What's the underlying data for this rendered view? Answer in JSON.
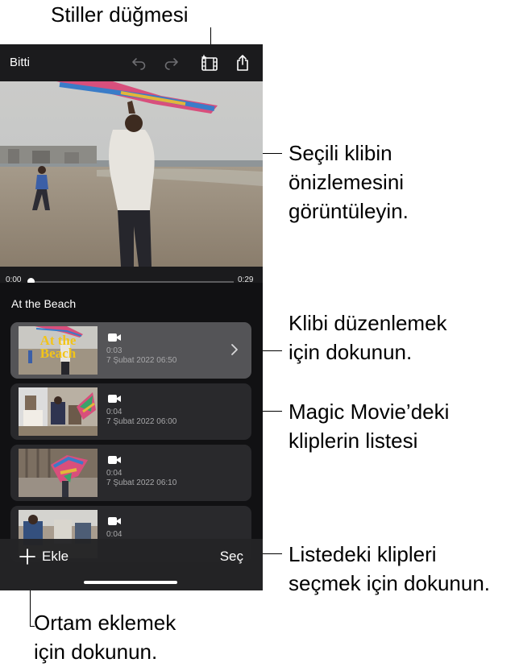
{
  "callouts": {
    "styles_button": "Stiller düğmesi",
    "preview": [
      "Seçili klibin",
      "önizlemesini",
      "görüntüleyin."
    ],
    "tap_edit": [
      "Klibi düzenlemek",
      "için dokunun."
    ],
    "clip_list": [
      "Magic Movie’deki",
      "kliplerin listesi"
    ],
    "select_clips": [
      "Listedeki klipleri",
      "seçmek için dokunun."
    ],
    "add_media": [
      "Ortam eklemek",
      "için dokunun."
    ]
  },
  "toolbar": {
    "done_label": "Bitti",
    "icons": [
      "undo-icon",
      "redo-icon",
      "styles-icon",
      "share-icon"
    ]
  },
  "player": {
    "current_time": "0:00",
    "total_time": "0:29",
    "progress": 0.0
  },
  "list": {
    "title": "At the Beach",
    "clips": [
      {
        "duration": "0:03",
        "date": "7 Şubat 2022 06:50",
        "thumb_title": [
          "At the",
          "Beach"
        ],
        "selected": true
      },
      {
        "duration": "0:04",
        "date": "7 Şubat 2022 06:00",
        "selected": false
      },
      {
        "duration": "0:04",
        "date": "7 Şubat 2022 06:10",
        "selected": false
      },
      {
        "duration": "0:04",
        "date": "",
        "selected": false
      }
    ]
  },
  "bottom": {
    "add_label": "Ekle",
    "select_label": "Seç"
  },
  "colors": {
    "app_background": "#1b1b1d",
    "list_background": "#111113",
    "clip_background": "#29292c",
    "clip_selected": "#545457",
    "title_yellow": "#f2c419"
  }
}
